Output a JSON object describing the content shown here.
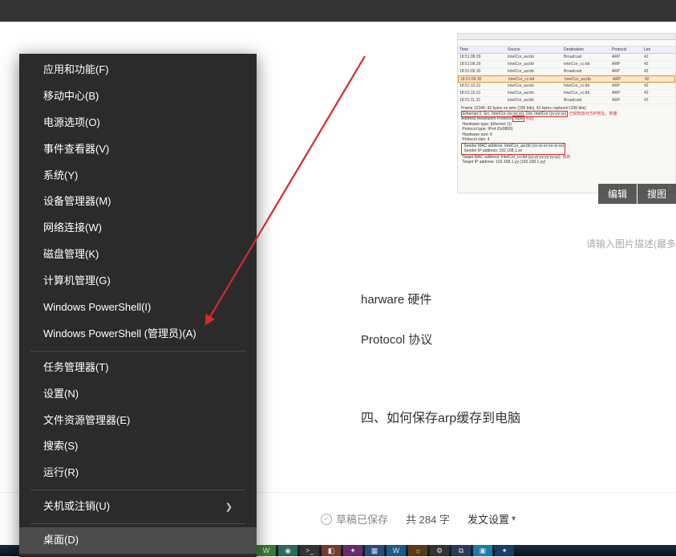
{
  "menu": {
    "items_g1": [
      "应用和功能(F)",
      "移动中心(B)",
      "电源选项(O)",
      "事件查看器(V)",
      "系统(Y)",
      "设备管理器(M)",
      "网络连接(W)",
      "磁盘管理(K)",
      "计算机管理(G)",
      "Windows PowerShell(I)",
      "Windows PowerShell (管理员)(A)"
    ],
    "items_g2": [
      "任务管理器(T)",
      "设置(N)",
      "文件资源管理器(E)",
      "搜索(S)",
      "运行(R)"
    ],
    "items_g3": [
      "关机或注销(U)"
    ],
    "items_g4": [
      "桌面(D)"
    ]
  },
  "overlay": {
    "edit": "编辑",
    "search_img": "搜图"
  },
  "caption_hint": "请输入图片描述(最多",
  "body": {
    "line1": "harware 硬件",
    "line2": "Protocol 协议",
    "line3": "四、如何保存arp缓存到电脑"
  },
  "footer": {
    "saved": "草稿已保存",
    "count": "共 284 字",
    "publish": "发文设置"
  },
  "thumb": {
    "red_text1": "已经知道对方IP地址，单播",
    "red_text2": "响应",
    "red_text3": "目的"
  }
}
